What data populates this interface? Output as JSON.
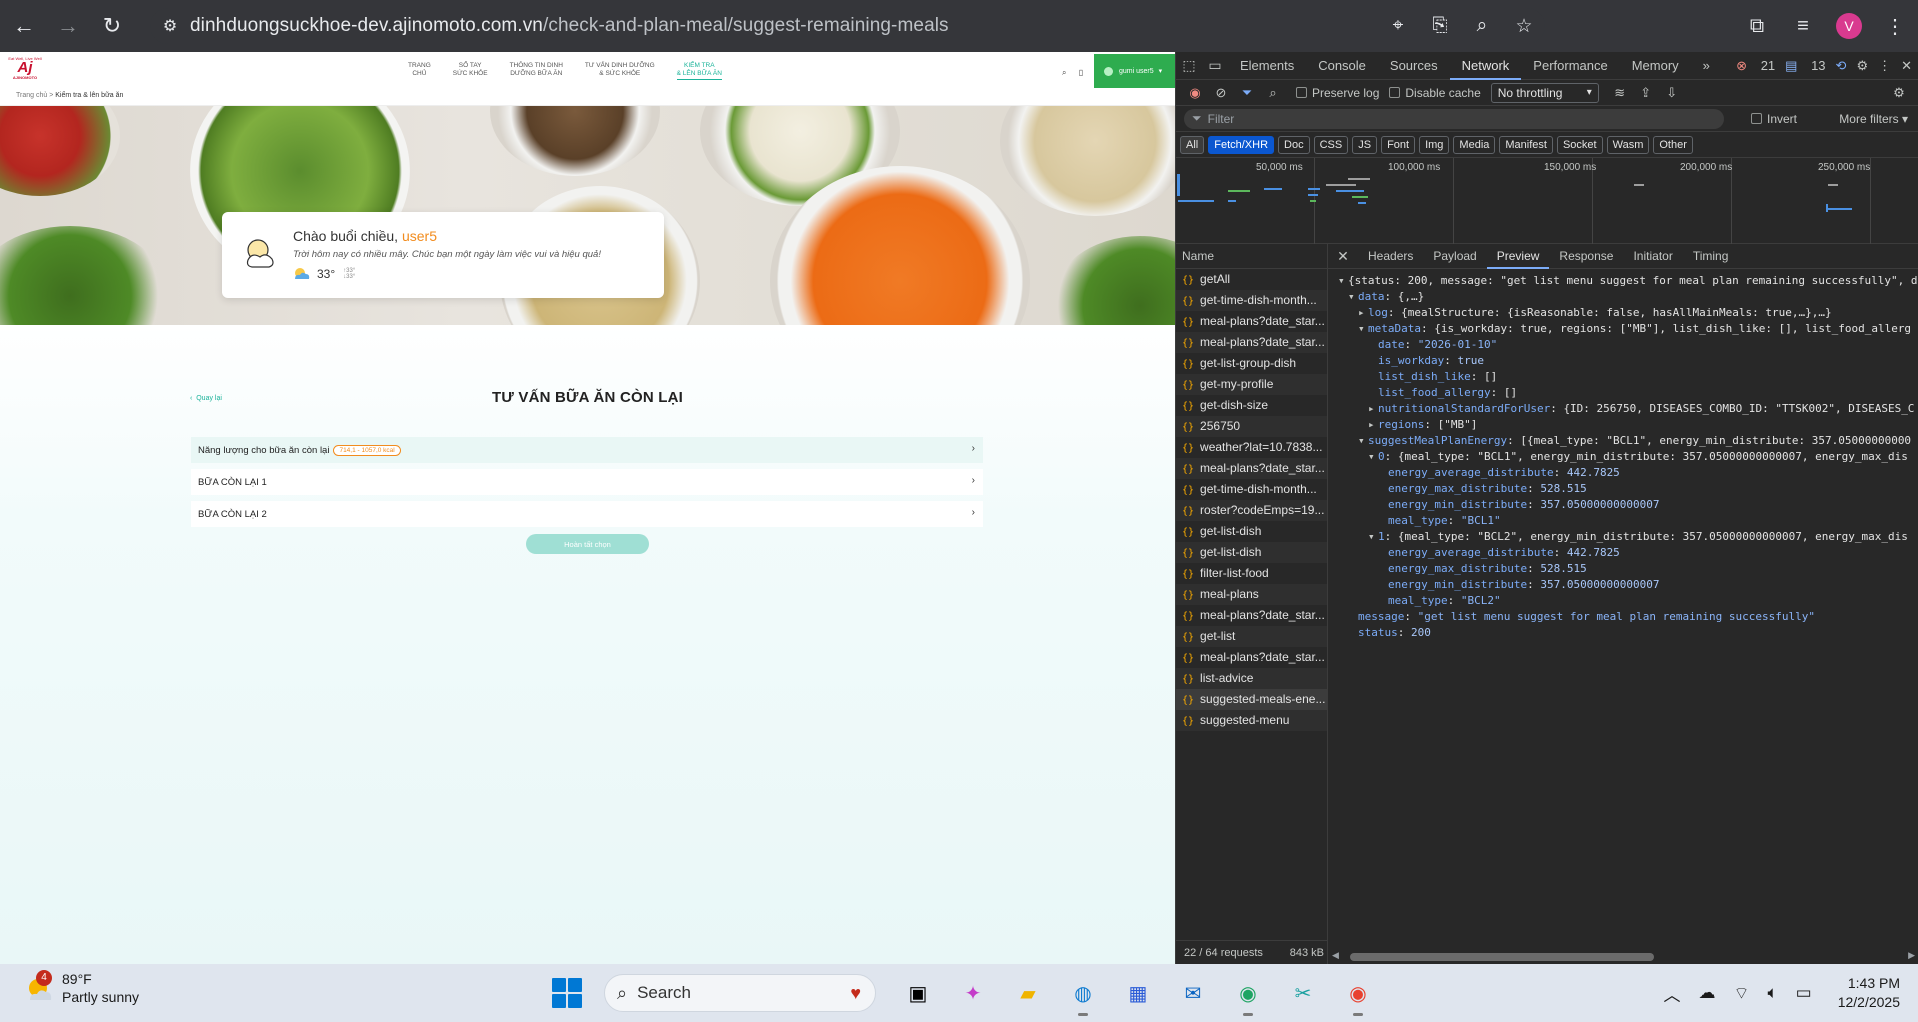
{
  "browser": {
    "url_host": "dinhduongsuckhoe-dev.ajinomoto.com.vn",
    "url_path": "/check-and-plan-meal/suggest-remaining-meals",
    "avatar_letter": "V"
  },
  "site": {
    "logo": {
      "tagline": "Eat Well, Live Well",
      "mark": "Aj",
      "word": "AJINOMOTO"
    },
    "breadcrumb": {
      "home": "Trang chủ",
      "sep": ">",
      "current": "Kiểm tra & lên bữa ăn"
    },
    "menu": [
      {
        "line1": "TRANG",
        "line2": "CHỦ"
      },
      {
        "line1": "SỔ TAY",
        "line2": "SỨC KHỎE"
      },
      {
        "line1": "THÔNG TIN DINH",
        "line2": "DƯỠNG BỮA ĂN"
      },
      {
        "line1": "TƯ VẤN DINH DƯỠNG",
        "line2": "& SỨC KHỎE"
      },
      {
        "line1": "KIỂM TRA",
        "line2": "& LÊN BỮA ĂN"
      }
    ],
    "user_pill": "gumi user5",
    "greeting": {
      "prefix": "Chào buổi chiều,",
      "username": "user5",
      "message": "Trời hôm nay có nhiều mây. Chúc bạn một ngày làm việc vui và hiệu quả!",
      "temperature": "33°",
      "temp_max": "33°",
      "temp_min": "33°"
    },
    "back_link": "Quay lại",
    "page_title": "TƯ VẤN BỮA ĂN CÒN LẠI",
    "energy_row": {
      "label": "Năng lượng cho bữa ăn còn lại",
      "badge": "714,1 - 1057,0 kcal"
    },
    "meal_rows": [
      "BỮA CÒN LẠI 1",
      "BỮA CÒN LẠI 2"
    ],
    "finish_button": "Hoàn tất chọn"
  },
  "devtools": {
    "tabs": [
      "Elements",
      "Console",
      "Sources",
      "Network",
      "Performance",
      "Memory"
    ],
    "active_tab": "Network",
    "error_count": "21",
    "message_count": "13",
    "preserve_log": "Preserve log",
    "disable_cache": "Disable cache",
    "throttling": "No throttling",
    "filter_placeholder": "Filter",
    "invert": "Invert",
    "more_filters": "More filters",
    "type_filters": [
      "All",
      "Fetch/XHR",
      "Doc",
      "CSS",
      "JS",
      "Font",
      "Img",
      "Media",
      "Manifest",
      "Socket",
      "Wasm",
      "Other"
    ],
    "timeline_labels": [
      "50,000 ms",
      "100,000 ms",
      "150,000 ms",
      "200,000 ms",
      "250,000 ms"
    ],
    "name_header": "Name",
    "requests": [
      "getAll",
      "get-time-dish-month...",
      "meal-plans?date_star...",
      "meal-plans?date_star...",
      "get-list-group-dish",
      "get-my-profile",
      "get-dish-size",
      "256750",
      "weather?lat=10.7838...",
      "meal-plans?date_star...",
      "get-time-dish-month...",
      "roster?codeEmps=19...",
      "get-list-dish",
      "get-list-dish",
      "filter-list-food",
      "meal-plans",
      "meal-plans?date_star...",
      "get-list",
      "meal-plans?date_star...",
      "list-advice",
      "suggested-meals-ene...",
      "suggested-menu"
    ],
    "selected_request": "suggested-meals-ene...",
    "request_count": "22 / 64 requests",
    "transfer_size": "843 kB",
    "detail_tabs": [
      "Headers",
      "Payload",
      "Preview",
      "Response",
      "Initiator",
      "Timing"
    ],
    "active_detail_tab": "Preview",
    "preview": {
      "root": "{status: 200, message: \"get list menu suggest for meal plan remaining successfully\", d",
      "data_summary": "{,…}",
      "log_summary": "{mealStructure: {isReasonable: false, hasAllMainMeals: true,…},…}",
      "metadata_summary": "{is_workday: true, regions: [\"MB\"], list_dish_like: [], list_food_allerg",
      "date": "\"2026-01-10\"",
      "is_workday": "true",
      "list_dish_like": "[]",
      "list_food_allergy": "[]",
      "nutritional_summary": "{ID: 256750, DISEASES_COMBO_ID: \"TTSK002\", DISEASES_C",
      "regions": "[\"MB\"]",
      "suggest_summary": "[{meal_type: \"BCL1\", energy_min_distribute: 357.05000000000",
      "item0_summary": "{meal_type: \"BCL1\", energy_min_distribute: 357.05000000000007, energy_max_dis",
      "item1_summary": "{meal_type: \"BCL2\", energy_min_distribute: 357.05000000000007, energy_max_dis",
      "energy_average_distribute": "442.7825",
      "energy_max_distribute": "528.515",
      "energy_min_distribute": "357.05000000000007",
      "meal_type_0": "\"BCL1\"",
      "meal_type_1": "\"BCL2\"",
      "message": "\"get list menu suggest for meal plan remaining successfully\"",
      "status": "200"
    }
  },
  "taskbar": {
    "weather_badge": "4",
    "weather_temp": "89°F",
    "weather_desc": "Partly sunny",
    "search_label": "Search",
    "time": "1:43 PM",
    "date": "12/2/2025"
  }
}
